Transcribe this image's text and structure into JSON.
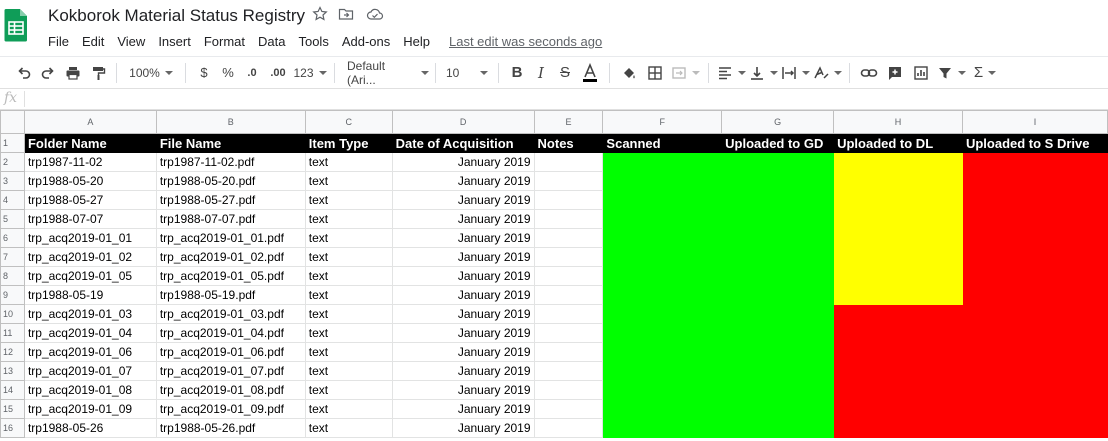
{
  "app": {
    "name": "Google Sheets"
  },
  "document": {
    "title": "Kokborok Material Status Registry"
  },
  "menu": {
    "items": [
      "File",
      "Edit",
      "View",
      "Insert",
      "Format",
      "Data",
      "Tools",
      "Add-ons",
      "Help"
    ],
    "last_edit": "Last edit was seconds ago"
  },
  "toolbar": {
    "zoom": "100%",
    "currency": "$",
    "percent": "%",
    "decimal_decrease": ".0",
    "decimal_increase": ".00",
    "more_formats": "123",
    "font": "Default (Ari...",
    "font_size": "10"
  },
  "formula_bar": {
    "label": "fx",
    "value": ""
  },
  "grid": {
    "column_letters": [
      "A",
      "B",
      "C",
      "D",
      "E",
      "F",
      "G",
      "H",
      "I"
    ],
    "headers": [
      "Folder Name",
      "File Name",
      "Item Type",
      "Date of Acquisition",
      "Notes",
      "Scanned",
      "Uploaded to GD",
      "Uploaded to DL",
      "Uploaded to S Drive"
    ],
    "status_colors": {
      "green": "#00ff00",
      "yellow": "#ffff00",
      "red": "#ff0000"
    },
    "rows": [
      {
        "n": "2",
        "folder": "trp1987-11-02",
        "file": "trp1987-11-02.pdf",
        "type": "text",
        "date": "January 2019",
        "notes": "",
        "status": [
          "green",
          "green",
          "yellow",
          "red"
        ]
      },
      {
        "n": "3",
        "folder": "trp1988-05-20",
        "file": "trp1988-05-20.pdf",
        "type": "text",
        "date": "January 2019",
        "notes": "",
        "status": [
          "green",
          "green",
          "yellow",
          "red"
        ]
      },
      {
        "n": "4",
        "folder": "trp1988-05-27",
        "file": "trp1988-05-27.pdf",
        "type": "text",
        "date": "January 2019",
        "notes": "",
        "status": [
          "green",
          "green",
          "yellow",
          "red"
        ]
      },
      {
        "n": "5",
        "folder": "trp1988-07-07",
        "file": "trp1988-07-07.pdf",
        "type": "text",
        "date": "January 2019",
        "notes": "",
        "status": [
          "green",
          "green",
          "yellow",
          "red"
        ]
      },
      {
        "n": "6",
        "folder": "trp_acq2019-01_01",
        "file": "trp_acq2019-01_01.pdf",
        "type": "text",
        "date": "January 2019",
        "notes": "",
        "status": [
          "green",
          "green",
          "yellow",
          "red"
        ]
      },
      {
        "n": "7",
        "folder": "trp_acq2019-01_02",
        "file": "trp_acq2019-01_02.pdf",
        "type": "text",
        "date": "January 2019",
        "notes": "",
        "status": [
          "green",
          "green",
          "yellow",
          "red"
        ]
      },
      {
        "n": "8",
        "folder": "trp_acq2019-01_05",
        "file": "trp_acq2019-01_05.pdf",
        "type": "text",
        "date": "January 2019",
        "notes": "",
        "status": [
          "green",
          "green",
          "yellow",
          "red"
        ]
      },
      {
        "n": "9",
        "folder": "trp1988-05-19",
        "file": "trp1988-05-19.pdf",
        "type": "text",
        "date": "January 2019",
        "notes": "",
        "status": [
          "green",
          "green",
          "yellow",
          "red"
        ]
      },
      {
        "n": "10",
        "folder": "trp_acq2019-01_03",
        "file": "trp_acq2019-01_03.pdf",
        "type": "text",
        "date": "January 2019",
        "notes": "",
        "status": [
          "green",
          "green",
          "red",
          "red"
        ]
      },
      {
        "n": "11",
        "folder": "trp_acq2019-01_04",
        "file": "trp_acq2019-01_04.pdf",
        "type": "text",
        "date": "January 2019",
        "notes": "",
        "status": [
          "green",
          "green",
          "red",
          "red"
        ]
      },
      {
        "n": "12",
        "folder": "trp_acq2019-01_06",
        "file": "trp_acq2019-01_06.pdf",
        "type": "text",
        "date": "January 2019",
        "notes": "",
        "status": [
          "green",
          "green",
          "red",
          "red"
        ]
      },
      {
        "n": "13",
        "folder": "trp_acq2019-01_07",
        "file": "trp_acq2019-01_07.pdf",
        "type": "text",
        "date": "January 2019",
        "notes": "",
        "status": [
          "green",
          "green",
          "red",
          "red"
        ]
      },
      {
        "n": "14",
        "folder": "trp_acq2019-01_08",
        "file": "trp_acq2019-01_08.pdf",
        "type": "text",
        "date": "January 2019",
        "notes": "",
        "status": [
          "green",
          "green",
          "red",
          "red"
        ]
      },
      {
        "n": "15",
        "folder": "trp_acq2019-01_09",
        "file": "trp_acq2019-01_09.pdf",
        "type": "text",
        "date": "January 2019",
        "notes": "",
        "status": [
          "green",
          "green",
          "red",
          "red"
        ]
      },
      {
        "n": "16",
        "folder": "trp1988-05-26",
        "file": "trp1988-05-26.pdf",
        "type": "text",
        "date": "January 2019",
        "notes": "",
        "status": [
          "green",
          "green",
          "red",
          "red"
        ]
      }
    ]
  }
}
